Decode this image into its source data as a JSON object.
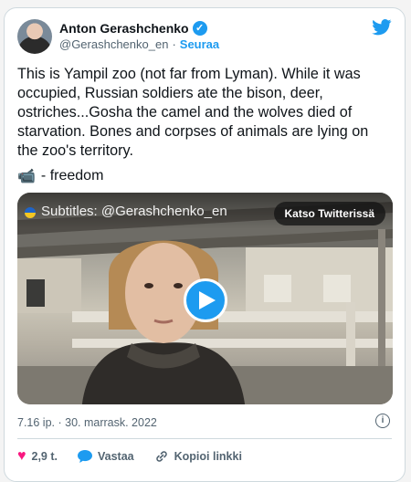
{
  "author": {
    "name": "Anton Gerashchenko",
    "verified_glyph": "✓",
    "handle": "@Gerashchenko_en",
    "separator": "·",
    "follow_label": "Seuraa"
  },
  "icons": {
    "brand": "twitter-bird-icon",
    "brand_color": "#1d9bf0",
    "like": "heart-icon",
    "reply": "speech-bubble-icon",
    "copy": "link-icon",
    "info": "info-icon"
  },
  "tweet": {
    "text": "This is Yampil zoo (not far from Lyman). While it was occupied, Russian soldiers ate the bison, deer, ostriches...Gosha the camel and the wolves died of starvation. Bones and corpses of animals are lying on the zoo's territory.",
    "freedom_emoji": "📹",
    "freedom_text": "- freedom"
  },
  "video": {
    "subtitle": "Subtitles: @Gerashchenko_en",
    "watch_label": "Katso Twitterissä"
  },
  "meta": {
    "timestamp": "7.16 ip. · 30. marrask. 2022",
    "info_glyph": "i"
  },
  "actions": {
    "like_glyph": "♥",
    "like_count": "2,9 t.",
    "reply_label": "Vastaa",
    "copy_label": "Kopioi linkki"
  }
}
